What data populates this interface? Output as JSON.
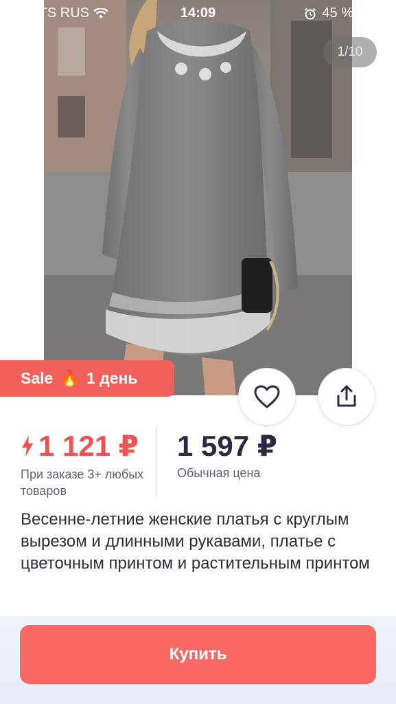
{
  "status_bar": {
    "carrier": "MTS RUS",
    "time": "14:09",
    "battery_percent": "45 %",
    "battery_level": 0.45
  },
  "gallery": {
    "counter": "1/10",
    "image_description_icon": "dress-photo"
  },
  "sale_badge": {
    "label": "Sale",
    "fire_icon": "🔥",
    "duration": "1 день"
  },
  "actions": {
    "favorite_icon": "heart-icon",
    "share_icon": "share-icon"
  },
  "price": {
    "sale_price": "1 121 ₽",
    "sale_condition": "При заказе 3+ любых товаров",
    "regular_price": "1 597 ₽",
    "regular_label": "Обычная цена"
  },
  "product": {
    "title": "Весенне-летние женские платья с круглым вырезом и длинными рукавами, платье с цветочным принтом и растительным принтом"
  },
  "buy_button": {
    "label": "Купить"
  },
  "colors": {
    "accent_red": "#f2605c",
    "price_red": "#f0524f",
    "buy_button": "#fa6866",
    "text_dark": "#2a2a40"
  }
}
